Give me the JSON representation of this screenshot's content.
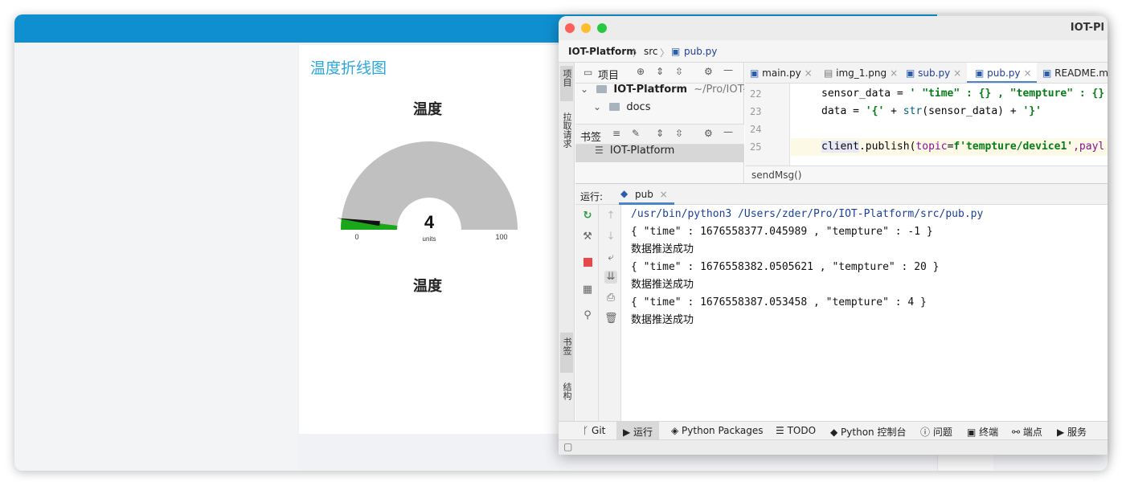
{
  "dashboard": {
    "card_title": "温度折线图",
    "gauge": {
      "title": "温度",
      "value": "4",
      "units": "units",
      "min": "0",
      "max": "100",
      "level": 4
    },
    "second_title": "温度"
  },
  "ide": {
    "window_title": "IOT-Pl",
    "breadcrumb": {
      "project": "IOT-Platform",
      "folder": "src",
      "file": "pub.py"
    },
    "left_tabs": {
      "project": "项目",
      "pull_requests": "拉取请求",
      "bookmarks": "书签",
      "structure": "结构"
    },
    "project_panel": {
      "title": "项目",
      "root_name": "IOT-Platform",
      "root_path": "~/Pro/IOT-Pla",
      "docs_folder": "docs"
    },
    "bookmarks_panel": {
      "title": "书签",
      "item": "IOT-Platform"
    },
    "editor_tabs": [
      "main.py",
      "img_1.png",
      "sub.py",
      "pub.py",
      "README.m"
    ],
    "line_numbers": [
      "22",
      "23",
      "24",
      "25"
    ],
    "code": {
      "line22_a": "sensor_data = ",
      "line22_b": "' \"time\" : {} , \"tempture\" : {}",
      "line23_a": "data = ",
      "line23_b": "'{'",
      "line23_c": " + ",
      "line23_d": "str",
      "line23_e": "(sensor_data) + ",
      "line23_f": "'}'",
      "line25_a": "client",
      "line25_b": ".publish(",
      "line25_c": "topic",
      "line25_d": "=",
      "line25_e": "f'tempture/device1'",
      "line25_f": ",payl"
    },
    "function_crumb": "sendMsg()",
    "run": {
      "label": "运行:",
      "tab": "pub"
    },
    "console_lines": [
      "/usr/bin/python3 /Users/zder/Pro/IOT-Platform/src/pub.py",
      "{ \"time\" : 1676558377.045989 , \"tempture\" : -1 }",
      "数据推送成功",
      "{ \"time\" : 1676558382.0505621 , \"tempture\" : 20 }",
      "数据推送成功",
      "{ \"time\" : 1676558387.053458 , \"tempture\" : 4 }",
      "数据推送成功"
    ],
    "status_items": {
      "git": "Git",
      "run": "运行",
      "packages": "Python Packages",
      "todo": "TODO",
      "console": "Python 控制台",
      "problems": "问题",
      "terminal": "终端",
      "endpoints": "端点",
      "services": "服务"
    }
  },
  "colors": {
    "header_blue": "#0f8fd0",
    "title_cyan": "#2aa7e0",
    "gauge_green": "#1aa81a",
    "gauge_gray": "#c0c0c0",
    "run_tab_underline": "#4a86c8"
  }
}
